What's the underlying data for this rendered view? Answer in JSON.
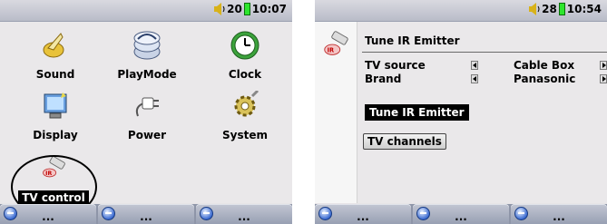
{
  "left_screen": {
    "status": {
      "volume": "20",
      "time": "10:07"
    },
    "menu": {
      "sound": "Sound",
      "playmode": "PlayMode",
      "clock": "Clock",
      "display": "Display",
      "power": "Power",
      "system": "System",
      "tv_control": "TV control"
    },
    "softkeys": [
      "...",
      "...",
      "..."
    ]
  },
  "right_screen": {
    "status": {
      "volume": "28",
      "time": "10:54"
    },
    "title": "Tune IR Emitter",
    "rows": [
      {
        "label": "TV source",
        "value": "Cable Box"
      },
      {
        "label": "Brand",
        "value": "Panasonic"
      }
    ],
    "tune_button": "Tune IR Emitter",
    "tv_channels_button": "TV channels",
    "softkeys": [
      "...",
      "...",
      "..."
    ]
  },
  "colors": {
    "accent": "#3b6bd1",
    "battery": "#2ee62e",
    "selected_bg": "#000000"
  }
}
